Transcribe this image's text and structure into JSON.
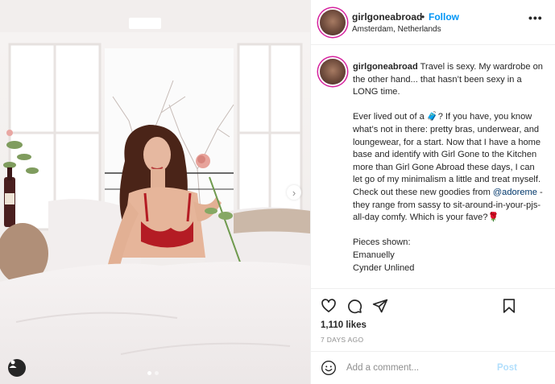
{
  "colors": {
    "follow": "#0095f6",
    "mention": "#00376b",
    "post_disabled": "#b2dffc",
    "secondary_text": "#8e8e8e",
    "divider": "#efefef"
  },
  "header": {
    "username": "girlgoneabroad",
    "separator": "•",
    "follow_label": "Follow",
    "location": "Amsterdam, Netherlands",
    "more_icon": "more-horizontal-icon",
    "more_label": "•••"
  },
  "caption": {
    "username": "girlgoneabroad",
    "text_1": "Travel is sexy. My wardrobe on the other hand... that hasn’t been sexy in a LONG time.\n\nEver lived out of a 🧳? If you have, you know what’s not in there: pretty bras, underwear, and loungewear, for a start. Now that I have a home base and identify with Girl Gone to the Kitchen more than Girl Gone Abroad these days, I can let go of my minimalism a little and treat myself. Check out these new goodies from ",
    "mention": "@adoreme",
    "text_2": " - they range from sassy to sit-around-in-your-pjs-all-day comfy. Which is your fave?🌹\n\nPieces shown:\nEmanuelly\nCynder Unlined"
  },
  "actions": {
    "like_icon": "heart-icon",
    "comment_icon": "comment-icon",
    "share_icon": "share-icon",
    "save_icon": "bookmark-icon",
    "likes": "1,110 likes",
    "time_ago": "7 DAYS AGO"
  },
  "add_comment": {
    "emoji_icon": "emoji-icon",
    "placeholder": "Add a comment...",
    "post_label": "Post"
  },
  "media": {
    "next_label": "›",
    "carousel_count": 2,
    "carousel_active": 1
  }
}
